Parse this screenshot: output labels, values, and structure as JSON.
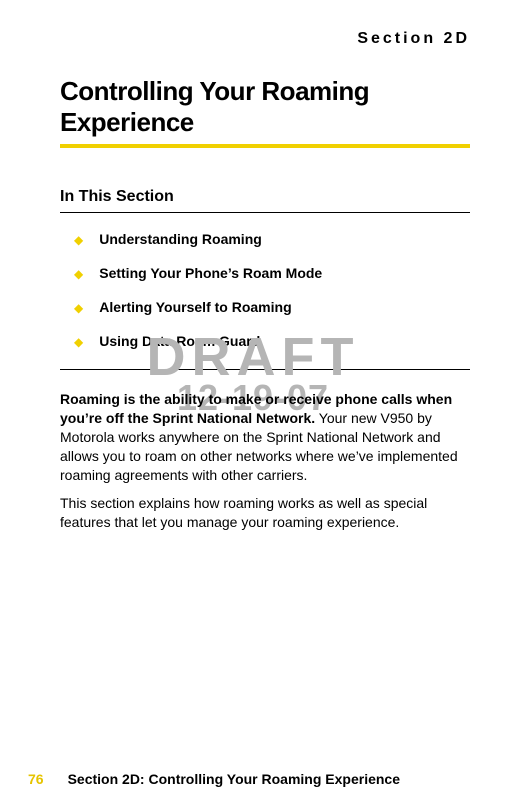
{
  "header": {
    "section_label": "Section 2D"
  },
  "title": "Controlling Your Roaming Experience",
  "in_this_section_label": "In This Section",
  "toc": [
    {
      "label": "Understanding Roaming"
    },
    {
      "label": "Setting Your Phone’s Roam Mode"
    },
    {
      "label": "Alerting Yourself to Roaming"
    },
    {
      "label": "Using Data Roam Guard"
    }
  ],
  "watermark": {
    "line1": "DRAFT",
    "line2": "12-19-07"
  },
  "body": {
    "para1_bold": "Roaming is the ability to make or receive phone calls when you’re off the Sprint National Network.",
    "para1_rest": " Your new V950 by Motorola works anywhere on the Sprint National Network and allows you to roam on other networks where we’ve implemented roaming agreements with other carriers.",
    "para2": "This section explains how roaming works as well as special features that let you manage your roaming experience."
  },
  "footer": {
    "page_number": "76",
    "text": "Section 2D: Controlling Your Roaming Experience"
  }
}
